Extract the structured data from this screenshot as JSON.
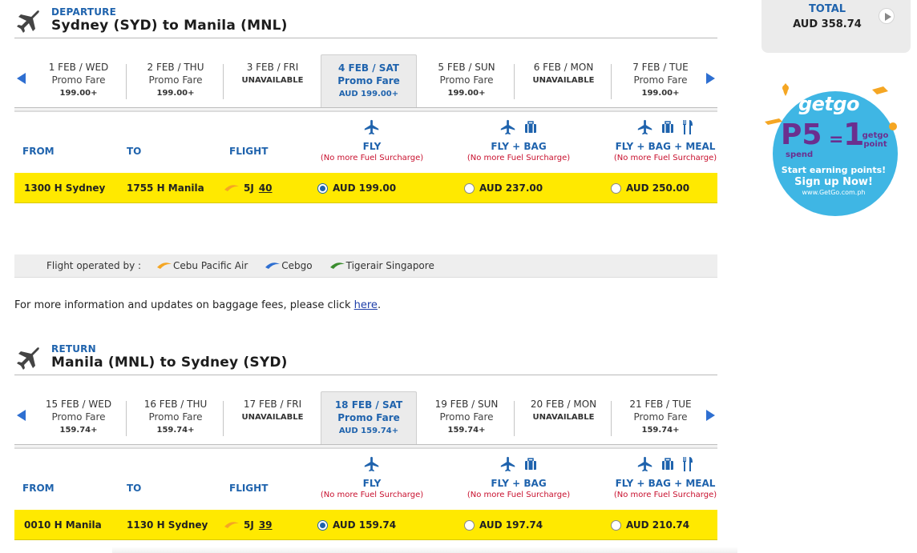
{
  "total": {
    "label": "TOTAL",
    "amount": "AUD  358.74"
  },
  "departure": {
    "label": "DEPARTURE",
    "route": "Sydney (SYD) to Manila (MNL)",
    "dates": [
      {
        "day": "1 FEB / WED",
        "fare": "Promo Fare",
        "price": "199.00+",
        "status": "available"
      },
      {
        "day": "2 FEB / THU",
        "fare": "Promo Fare",
        "price": "199.00+",
        "status": "available"
      },
      {
        "day": "3 FEB / FRI",
        "unavailable": "UNAVAILABLE",
        "status": "unavailable"
      },
      {
        "day": "4 FEB / SAT",
        "fare": "Promo Fare",
        "price": "AUD 199.00+",
        "status": "selected"
      },
      {
        "day": "5 FEB / SUN",
        "fare": "Promo Fare",
        "price": "199.00+",
        "status": "available"
      },
      {
        "day": "6 FEB / MON",
        "unavailable": "UNAVAILABLE",
        "status": "unavailable"
      },
      {
        "day": "7 FEB / TUE",
        "fare": "Promo Fare",
        "price": "199.00+",
        "status": "available"
      }
    ],
    "headers": {
      "from": "FROM",
      "to": "TO",
      "flight": "FLIGHT"
    },
    "fares": [
      {
        "name": "FLY",
        "note": "(No more Fuel Surcharge)"
      },
      {
        "name": "FLY + BAG",
        "note": "(No more Fuel Surcharge)"
      },
      {
        "name": "FLY + BAG + MEAL",
        "note": "(No more Fuel Surcharge)"
      }
    ],
    "flight": {
      "from": "1300 H  Sydney",
      "to": "1755 H  Manila",
      "code": "5J",
      "number": "40",
      "prices": [
        "AUD 199.00",
        "AUD 237.00",
        "AUD 250.00"
      ],
      "selected": 0
    }
  },
  "operated": {
    "label": "Flight operated by :",
    "airlines": [
      {
        "name": "Cebu Pacific Air",
        "color": "#f5a623"
      },
      {
        "name": "Cebgo",
        "color": "#2e6fd1"
      },
      {
        "name": "Tigerair Singapore",
        "color": "#3a8c2e"
      }
    ]
  },
  "info": {
    "text": "For more information and updates on baggage fees, please click ",
    "link": "here",
    "end": "."
  },
  "return": {
    "label": "RETURN",
    "route": "Manila (MNL) to Sydney (SYD)",
    "dates": [
      {
        "day": "15 FEB / WED",
        "fare": "Promo Fare",
        "price": "159.74+",
        "status": "available"
      },
      {
        "day": "16 FEB / THU",
        "fare": "Promo Fare",
        "price": "159.74+",
        "status": "available"
      },
      {
        "day": "17 FEB / FRI",
        "unavailable": "UNAVAILABLE",
        "status": "unavailable"
      },
      {
        "day": "18 FEB / SAT",
        "fare": "Promo Fare",
        "price": "AUD 159.74+",
        "status": "selected"
      },
      {
        "day": "19 FEB / SUN",
        "fare": "Promo Fare",
        "price": "159.74+",
        "status": "available"
      },
      {
        "day": "20 FEB / MON",
        "unavailable": "UNAVAILABLE",
        "status": "unavailable"
      },
      {
        "day": "21 FEB / TUE",
        "fare": "Promo Fare",
        "price": "159.74+",
        "status": "available"
      }
    ],
    "headers": {
      "from": "FROM",
      "to": "TO",
      "flight": "FLIGHT"
    },
    "fares": [
      {
        "name": "FLY",
        "note": "(No more Fuel Surcharge)"
      },
      {
        "name": "FLY + BAG",
        "note": "(No more Fuel Surcharge)"
      },
      {
        "name": "FLY + BAG + MEAL",
        "note": "(No more Fuel Surcharge)"
      }
    ],
    "flight": {
      "from": "0010 H  Manila",
      "to": "1130 H  Sydney",
      "code": "5J",
      "number": "39",
      "prices": [
        "AUD 159.74",
        "AUD 197.74",
        "AUD 210.74"
      ],
      "selected": 0
    }
  },
  "promo": {
    "brand": "getgo",
    "p5": "P5",
    "spend": "spend",
    "eq": "=",
    "one": "1",
    "point": "getgo point",
    "earn": "Start earning points!",
    "signup": "Sign up Now!",
    "url": "www.GetGo.com.ph"
  },
  "colors": {
    "accent": "#1f63ad",
    "highlight": "#ffe900",
    "surcharge": "#c8102e"
  }
}
